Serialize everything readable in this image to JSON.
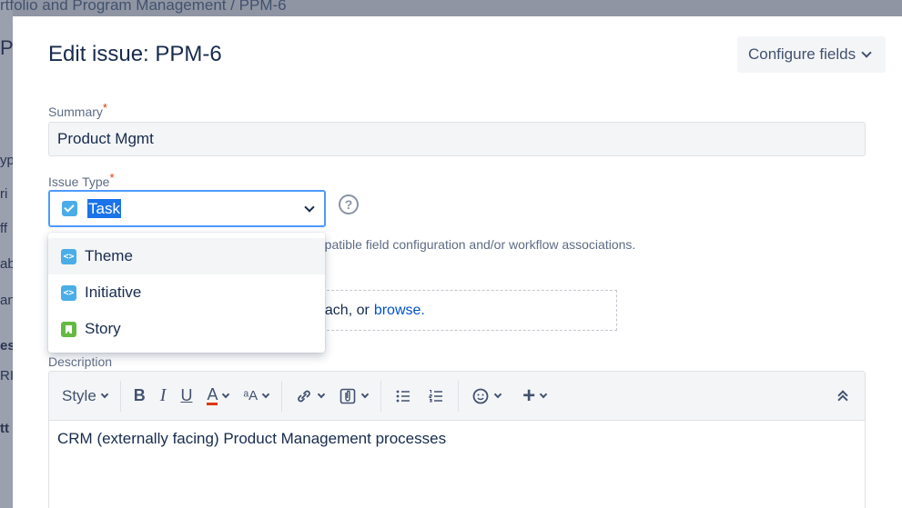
{
  "background": {
    "breadcrumb": "rtfolio and Program Management  /  PPM-6",
    "fragments": [
      "Pr",
      "yp",
      "ri",
      "ff",
      "ab",
      "an",
      "es",
      "RI",
      "tt"
    ]
  },
  "modal": {
    "title": "Edit issue: PPM-6",
    "configure_label": "Configure fields"
  },
  "fields": {
    "summary": {
      "label": "Summary",
      "required": "*",
      "value": "Product Mgmt"
    },
    "issue_type": {
      "label": "Issue Type",
      "required": "*",
      "selected": "Task",
      "help_glyph": "?",
      "hint": "mpatible field configuration and/or workflow associations.",
      "options": [
        {
          "label": "Theme",
          "icon": "epic-icon",
          "color": "#4bade8",
          "glyph": "<>"
        },
        {
          "label": "Initiative",
          "icon": "epic-icon",
          "color": "#4bade8",
          "glyph": "<>"
        },
        {
          "label": "Story",
          "icon": "story-icon",
          "color": "#65ba43",
          "glyph": ""
        }
      ]
    },
    "attachment": {
      "text": "ttach, or",
      "link": "browse."
    },
    "description": {
      "label": "Description",
      "value": "CRM (externally facing) Product Management processes"
    }
  },
  "toolbar": {
    "style": "Style",
    "bold": "B",
    "italic": "I",
    "underline": "U",
    "text_color": "A",
    "text_effects": "ᵃA",
    "emoji": "☺",
    "insert": "+"
  }
}
